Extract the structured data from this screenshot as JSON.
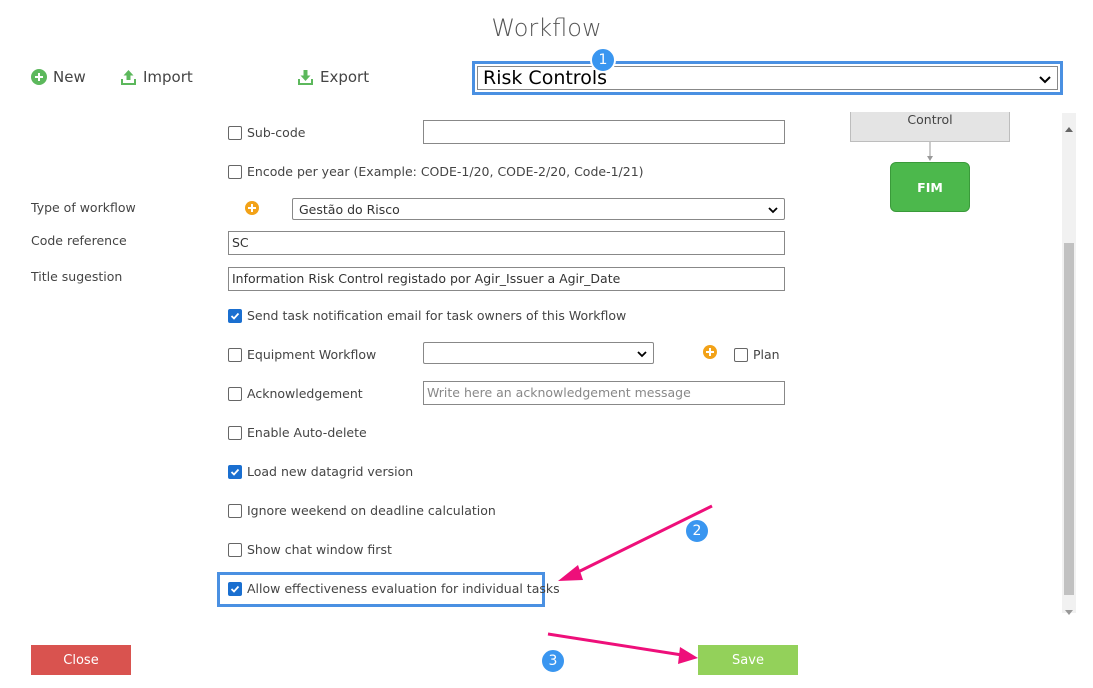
{
  "page": {
    "title": "Workflow"
  },
  "toolbar": {
    "new_label": "New",
    "import_label": "Import",
    "export_label": "Export"
  },
  "workflow_select": {
    "value": "Risk Controls"
  },
  "badges": {
    "one": "1",
    "two": "2",
    "three": "3"
  },
  "form": {
    "subcode_label": "Sub-code",
    "subcode_value": "",
    "encode_per_year_label": "Encode per year (Example: CODE-1/20, CODE-2/20, Code-1/21)",
    "type_of_workflow_label": "Type of workflow",
    "type_of_workflow_value": "Gestão do Risco",
    "code_reference_label": "Code reference",
    "code_reference_value": "SC",
    "title_suggestion_label": "Title sugestion",
    "title_suggestion_value": "Information Risk Control registado por Agir_Issuer a Agir_Date",
    "send_notification_label": "Send task notification email for task owners of this Workflow",
    "equipment_workflow_label": "Equipment Workflow",
    "equipment_workflow_value": "",
    "plan_label": "Plan",
    "acknowledgement_label": "Acknowledgement",
    "acknowledgement_placeholder": "Write here an acknowledgement message",
    "auto_delete_label": "Enable Auto-delete",
    "datagrid_label": "Load new datagrid version",
    "ignore_weekend_label": "Ignore weekend on deadline calculation",
    "chat_first_label": "Show chat window first",
    "effectiveness_label": "Allow effectiveness evaluation for individual tasks"
  },
  "checkboxes": {
    "subcode": false,
    "encode_per_year": false,
    "send_notification": true,
    "equipment_workflow": false,
    "plan": false,
    "acknowledgement": false,
    "auto_delete": false,
    "datagrid": true,
    "ignore_weekend": false,
    "chat_first": false,
    "effectiveness": true
  },
  "diagram": {
    "control_label": "Control",
    "fim_label": "FIM"
  },
  "footer": {
    "close_label": "Close",
    "save_label": "Save"
  },
  "colors": {
    "accent_blue": "#4a90e2",
    "badge_blue": "#3a96f0",
    "annotation_pink": "#ee0f7a",
    "close_red": "#d9534f",
    "save_green": "#93d15a",
    "fim_green": "#4cb84c",
    "plus_orange": "#f2a218"
  },
  "icons": {
    "new": "plus-circle-icon",
    "import": "upload-icon",
    "export": "download-icon",
    "dropdown": "chevron-down-icon"
  }
}
